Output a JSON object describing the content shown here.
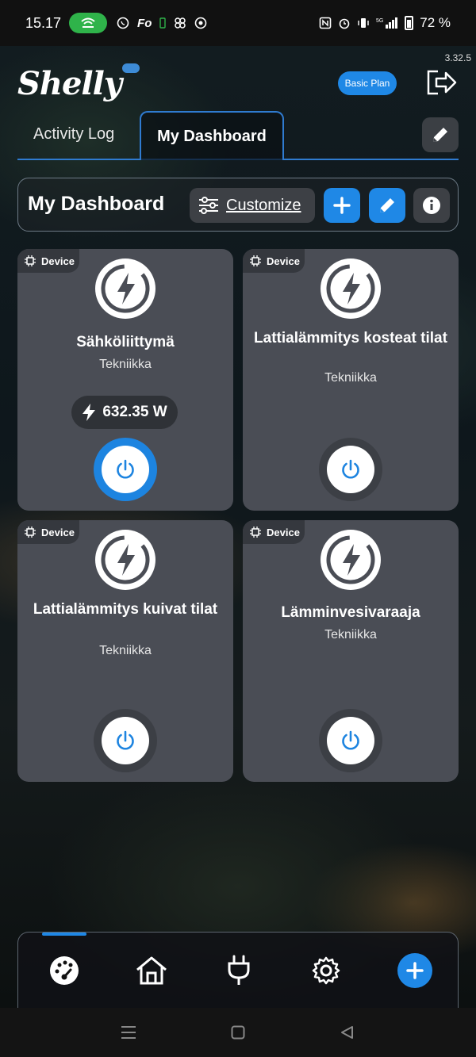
{
  "status_bar": {
    "time": "15.17",
    "battery": "72 %",
    "icons_left": [
      "hotspot-icon",
      "whatsapp-icon",
      "fo-icon",
      "battery-saver-icon",
      "pinwheel-icon",
      "chrome-icon"
    ],
    "icons_right": [
      "nfc-icon",
      "alarm-icon",
      "vibrate-icon",
      "5g-signal-icon",
      "battery-icon"
    ],
    "fo_text": "Fo"
  },
  "app": {
    "version": "3.32.5",
    "logo": "Shelly",
    "plan_badge": "Basic Plan"
  },
  "tabs": {
    "items": [
      {
        "label": "Activity Log",
        "active": false
      },
      {
        "label": "My Dashboard",
        "active": true
      }
    ]
  },
  "dashboard": {
    "title": "My Dashboard",
    "customize_label": "Customize"
  },
  "cards": [
    {
      "badge": "Device",
      "name": "Sähköliittymä",
      "room": "Tekniikka",
      "power": "632.35 W",
      "on": true
    },
    {
      "badge": "Device",
      "name": "Lattialämmitys kosteat tilat",
      "room": "Tekniikka",
      "on": false
    },
    {
      "badge": "Device",
      "name": "Lattialämmitys kuivat tilat",
      "room": "Tekniikka",
      "on": false
    },
    {
      "badge": "Device",
      "name": "Lämminvesivaraaja",
      "room": "Tekniikka",
      "on": false
    }
  ],
  "bottom_nav": [
    "dashboard-icon",
    "home-icon",
    "plug-icon",
    "settings-icon",
    "add-icon"
  ],
  "colors": {
    "accent": "#1f88e6",
    "card": "#4a4d55",
    "toggle_on": "#1d84e0"
  }
}
